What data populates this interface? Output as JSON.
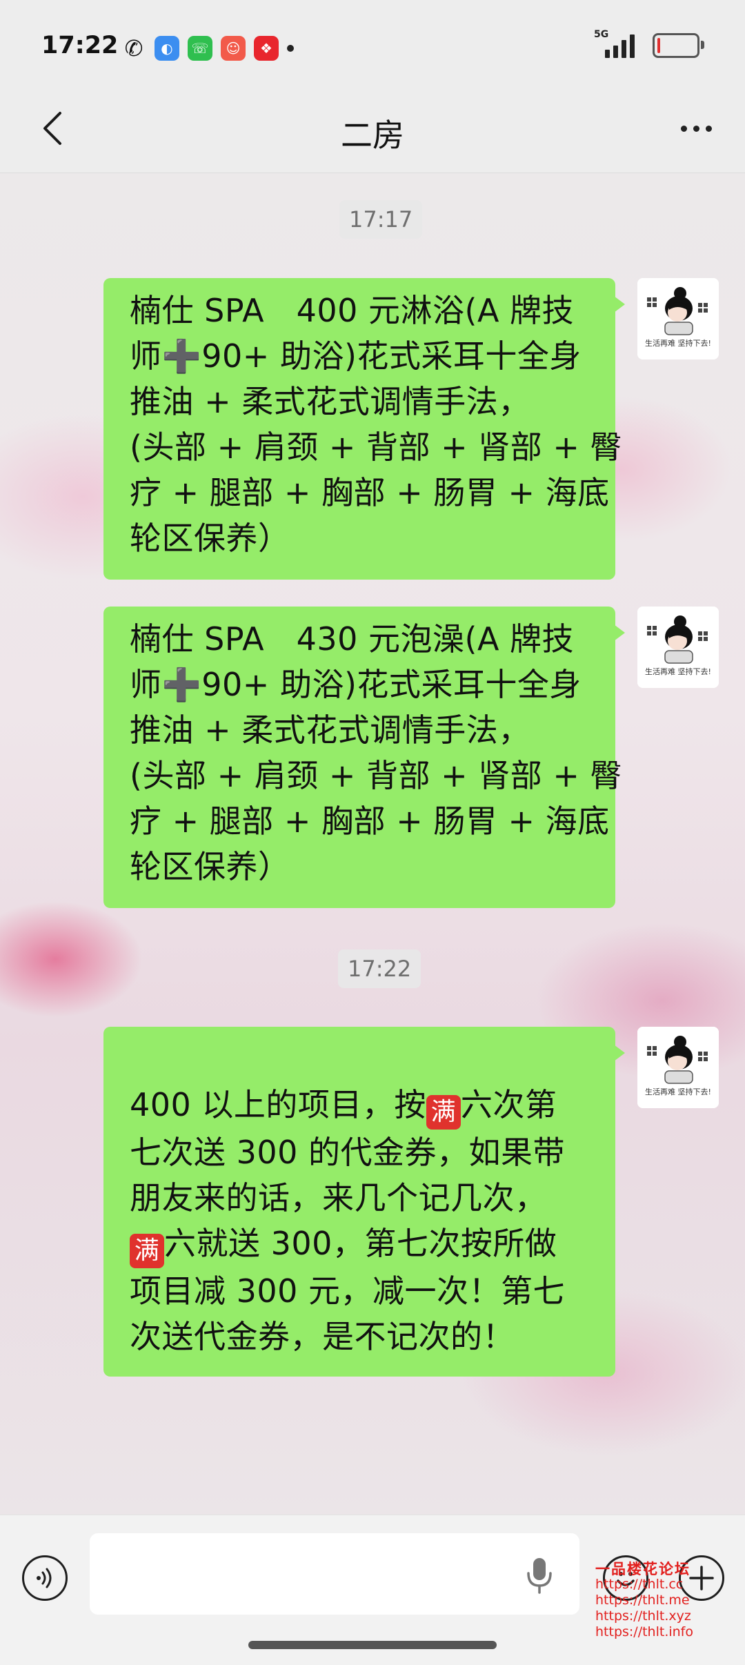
{
  "status_bar": {
    "time": "17:22",
    "app_icons": [
      "wechat-icon",
      "browser-icon",
      "phone-icon",
      "clown-app-icon",
      "red-app-icon"
    ],
    "network": "5G",
    "battery_level": 0.08
  },
  "nav": {
    "title": "二房"
  },
  "messages": [
    {
      "type": "timestamp",
      "text": "17:17"
    },
    {
      "type": "outgoing",
      "lines": [
        "楠仕 SPA　400 元淋浴(A 牌技",
        "师➕90+ 助浴)花式采耳十全身",
        "推油 + 柔式花式调情手法，",
        "(头部 + 肩颈 + 背部 + 肾部 + 臀",
        "疗 + 腿部 + 胸部 + 肠胃 + 海底",
        "轮区保养）"
      ]
    },
    {
      "type": "outgoing",
      "lines": [
        "楠仕 SPA　430 元泡澡(A 牌技",
        "师➕90+ 助浴)花式采耳十全身",
        "推油 + 柔式花式调情手法，",
        "(头部 + 肩颈 + 背部 + 肾部 + 臀",
        "疗 + 腿部 + 胸部 + 肠胃 + 海底",
        "轮区保养）"
      ]
    },
    {
      "type": "timestamp",
      "text": "17:22"
    },
    {
      "type": "outgoing",
      "line1_before": "400 以上的项目，按",
      "badge": "满",
      "line1_after": "六次第",
      "line2": "七次送 300 的代金券，如果带",
      "line3": "朋友来的话，来几个记几次，",
      "line4_after": "六就送 300，第七次按所做",
      "line5": "项目减 300 元，减一次！第七",
      "line6": "次送代金券，是不记次的！"
    }
  ],
  "avatar_caption": "生活再难 坚持下去!",
  "watermark": {
    "title": "一品楼花论坛",
    "urls": [
      "https://thlt.cc",
      "https://thlt.me",
      "https://thlt.xyz",
      "https://thlt.info"
    ]
  },
  "colors": {
    "bubble_green": "#95ec69",
    "bar_bg": "#ededed",
    "badge_red": "#e0322d",
    "watermark_red": "#e2201e"
  }
}
